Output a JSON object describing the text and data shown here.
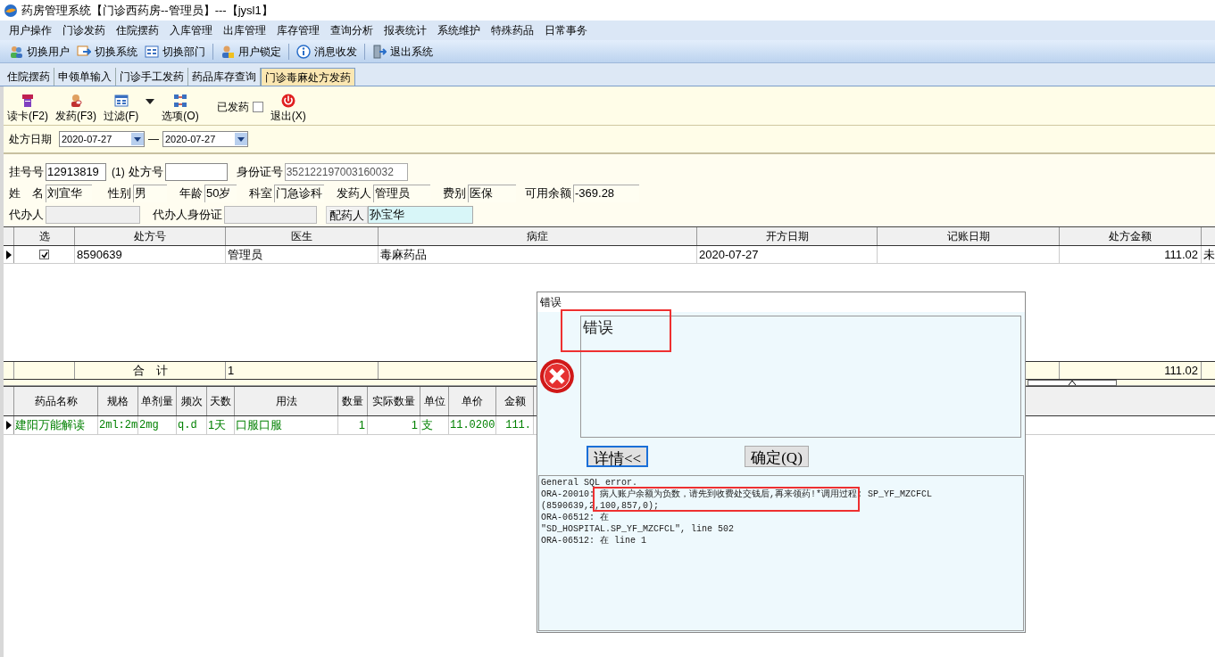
{
  "window": {
    "title": "药房管理系统【门诊西药房--管理员】---【jysl1】"
  },
  "menu": [
    "用户操作",
    "门诊发药",
    "住院摆药",
    "入库管理",
    "出库管理",
    "库存管理",
    "查询分析",
    "报表统计",
    "系统维护",
    "特殊药品",
    "日常事务"
  ],
  "toolbar": [
    "切换用户",
    "切换系统",
    "切换部门",
    "用户锁定",
    "消息收发",
    "退出系统"
  ],
  "tabs": [
    {
      "label": "住院摆药",
      "selected": false
    },
    {
      "label": "申领单输入",
      "selected": false
    },
    {
      "label": "门诊手工发药",
      "selected": false
    },
    {
      "label": "药品库存查询",
      "selected": false
    },
    {
      "label": "门诊毒麻处方发药",
      "selected": true
    }
  ],
  "actions": [
    {
      "label": "读卡(F2)"
    },
    {
      "label": "发药(F3)"
    },
    {
      "label": "过滤(F)"
    },
    {
      "label": "选项(O)"
    }
  ],
  "dispensed_filter": {
    "label": "已发药",
    "checked": false
  },
  "exit_action": {
    "label": "退出(X)"
  },
  "date_filter": {
    "label": "处方日期",
    "from": "2020-07-27",
    "separator": "—",
    "to": "2020-07-27"
  },
  "patient_rows": [
    [
      {
        "label": "挂号号",
        "value": "12913819",
        "kind": "input"
      },
      {
        "label": "(1)",
        "kind": "link"
      },
      {
        "label": "处方号",
        "kind": "input"
      },
      {
        "label": "身份证号",
        "value": "352122197003160032",
        "kind": "readonly"
      }
    ],
    [
      {
        "label": "姓　名",
        "value": "刘宜华",
        "kind": "display"
      },
      {
        "label": "性别",
        "value": "男",
        "kind": "display"
      },
      {
        "label": "年龄",
        "value": "50岁",
        "kind": "display"
      },
      {
        "label": "科室",
        "value": "门急诊科",
        "kind": "display"
      },
      {
        "label": "发药人",
        "value": "管理员",
        "kind": "display"
      },
      {
        "label": "费别",
        "value": "医保",
        "kind": "display"
      },
      {
        "label": "可用余额",
        "value": "-369.28",
        "kind": "display"
      }
    ],
    [
      {
        "label": "代办人",
        "kind": "disabled"
      },
      {
        "label": "代办人身份证",
        "kind": "disabled"
      },
      {
        "label": "配药人",
        "value": "孙宝华",
        "kind": "highlight"
      }
    ]
  ],
  "prescriptions": {
    "columns": [
      "选",
      "处方号",
      "医生",
      "病症",
      "开方日期",
      "记账日期",
      "处方金额"
    ],
    "rows": [
      {
        "current": true,
        "checked": true,
        "cells": [
          "8590639",
          "管理员",
          "毒麻药品",
          "2020-07-27",
          "",
          "111.02",
          "未"
        ]
      }
    ],
    "totals": {
      "label": "合　计",
      "count": "1",
      "amount": "111.02"
    }
  },
  "drugs": {
    "columns": [
      "药品名称",
      "规格",
      "单剂量",
      "频次",
      "天数",
      "用法",
      "数量",
      "实际数量",
      "单位",
      "单价",
      "金额"
    ],
    "rows": [
      {
        "current": true,
        "cells": [
          "建阳万能解读",
          "2ml:2m",
          "2mg",
          "q.d",
          "1天",
          "口服口服",
          "1",
          "1",
          "支",
          "11.0200",
          "111."
        ]
      }
    ]
  },
  "dialog": {
    "title": "错误",
    "message": "错误",
    "buttons": [
      {
        "label": "详情<<",
        "focused": true
      },
      {
        "label": "确定(Q)",
        "focused": false
      }
    ],
    "details": [
      "General SQL error.",
      "ORA-20010: 病人账户余额为负数，请先到收费处交钱后,再来领药!*调用过程: SP_YF_MZCFCL",
      "(8590639,2,100,857,0);",
      "ORA-06512: 在",
      "\"SD_HOSPITAL.SP_YF_MZCFCL\", line 502",
      "ORA-06512: 在 line 1"
    ]
  }
}
